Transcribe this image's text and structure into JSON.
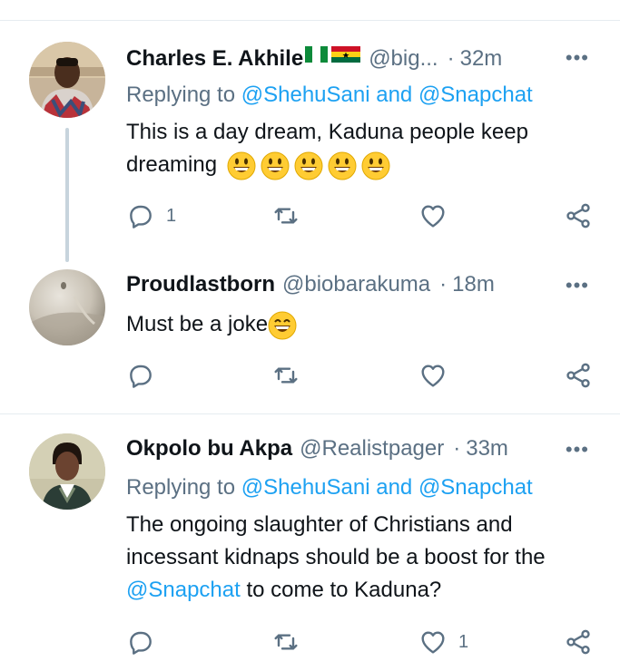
{
  "tweets": [
    {
      "name": "Charles E. Akhile",
      "handle": "@big...",
      "time": "32m",
      "reply_prefix": "Replying to",
      "reply_to_1": "@ShehuSani",
      "reply_and": "and",
      "reply_to_2": "@Snapchat",
      "text": "This is a day dream,  Kaduna people keep dreaming",
      "reply_count": "1",
      "like_count": ""
    },
    {
      "name": "Proudlastborn",
      "handle": "@biobarakuma",
      "time": "18m",
      "text": "Must be a joke",
      "reply_count": "",
      "like_count": ""
    },
    {
      "name": "Okpolo bu Akpa",
      "handle": "@Realistpager",
      "time": "33m",
      "reply_prefix": "Replying to",
      "reply_to_1": "@ShehuSani",
      "reply_and": "and",
      "reply_to_2": "@Snapchat",
      "text_part1": "The ongoing slaughter of Christians and incessant kidnaps should be a boost for the",
      "text_mention": "@Snapchat",
      "text_part2": "to come to Kaduna?",
      "reply_count": "",
      "like_count": "1"
    }
  ],
  "icons": {
    "reply": "reply-icon",
    "retweet": "retweet-icon",
    "like": "heart-icon",
    "share": "share-icon",
    "more": "more-icon"
  },
  "more_glyph": "•••",
  "dot": "·",
  "colors": {
    "accent": "#1da1f2",
    "secondary": "#5b7083",
    "separator": "#e6ecf0"
  }
}
